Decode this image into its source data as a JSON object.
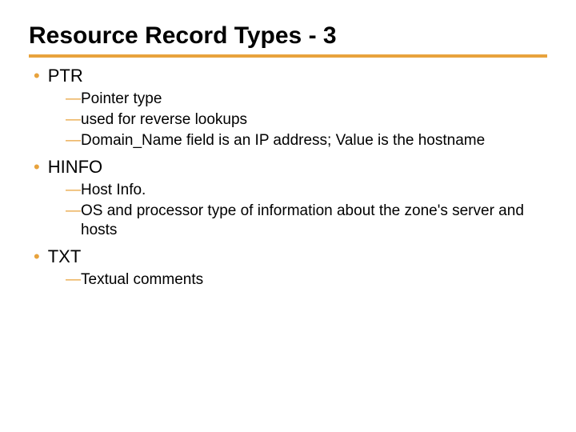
{
  "title": "Resource Record Types - 3",
  "items": [
    {
      "label": "PTR",
      "subs": [
        "Pointer type",
        "used for reverse lookups",
        "Domain_Name field is an IP address; Value is the hostname"
      ]
    },
    {
      "label": "HINFO",
      "subs": [
        "Host Info.",
        "OS and processor type of information about the zone's server and hosts"
      ]
    },
    {
      "label": "TXT",
      "subs": [
        "Textual comments"
      ]
    }
  ]
}
